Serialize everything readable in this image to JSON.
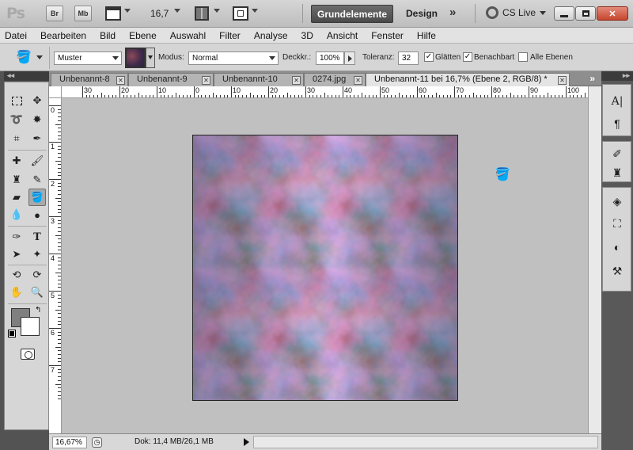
{
  "app": {
    "logo": "Ps",
    "bridge_label": "Br",
    "minibridge_label": "Mb",
    "zoom_value": "16,7",
    "workspace_active": "Grundelemente",
    "workspace_design": "Design",
    "workspace_more": "»",
    "cslive_label": "CS Live"
  },
  "menu": [
    "Datei",
    "Bearbeiten",
    "Bild",
    "Ebene",
    "Auswahl",
    "Filter",
    "Analyse",
    "3D",
    "Ansicht",
    "Fenster",
    "Hilfe"
  ],
  "options": {
    "fill_source": "Muster",
    "mode_label": "Modus:",
    "mode_value": "Normal",
    "opacity_label": "Deckkr.:",
    "opacity_value": "100%",
    "tolerance_label": "Toleranz:",
    "tolerance_value": "32",
    "smooth_label": "Glätten",
    "smooth_checked": true,
    "contiguous_label": "Benachbart",
    "contiguous_checked": true,
    "all_layers_label": "Alle Ebenen",
    "all_layers_checked": false
  },
  "tabs": [
    {
      "label": "Unbenannt-8",
      "active": false
    },
    {
      "label": "Unbenannt-9",
      "active": false
    },
    {
      "label": "Unbenannt-10",
      "active": false
    },
    {
      "label": "0274.jpg",
      "active": false
    },
    {
      "label": "Unbenannt-11 bei 16,7% (Ebene 2, RGB/8) *",
      "active": true
    }
  ],
  "ruler_top": [
    "30",
    "20",
    "10",
    "0",
    "10",
    "20",
    "30",
    "40",
    "50",
    "60",
    "70",
    "80",
    "90",
    "100"
  ],
  "ruler_left": [
    "0",
    "1",
    "2",
    "3",
    "4",
    "5",
    "6",
    "7"
  ],
  "status": {
    "zoom": "16,67%",
    "doc_info": "Dok: 11,4 MB/26,1 MB"
  },
  "colors": {
    "foreground": "#7f7f7f",
    "background": "#ffffff",
    "canvas_area": "#c0c0c0",
    "workspace_active": "#555555"
  },
  "tools_panel": {
    "collapse_label": "◂◂"
  },
  "right_dock": {
    "collapse_label": "▸▸",
    "icons": [
      "character-icon",
      "paragraph-icon",
      "brushes-icon",
      "clone-source-icon",
      "layers-icon",
      "paths-icon",
      "adjustments-icon",
      "tool-presets-icon"
    ]
  }
}
